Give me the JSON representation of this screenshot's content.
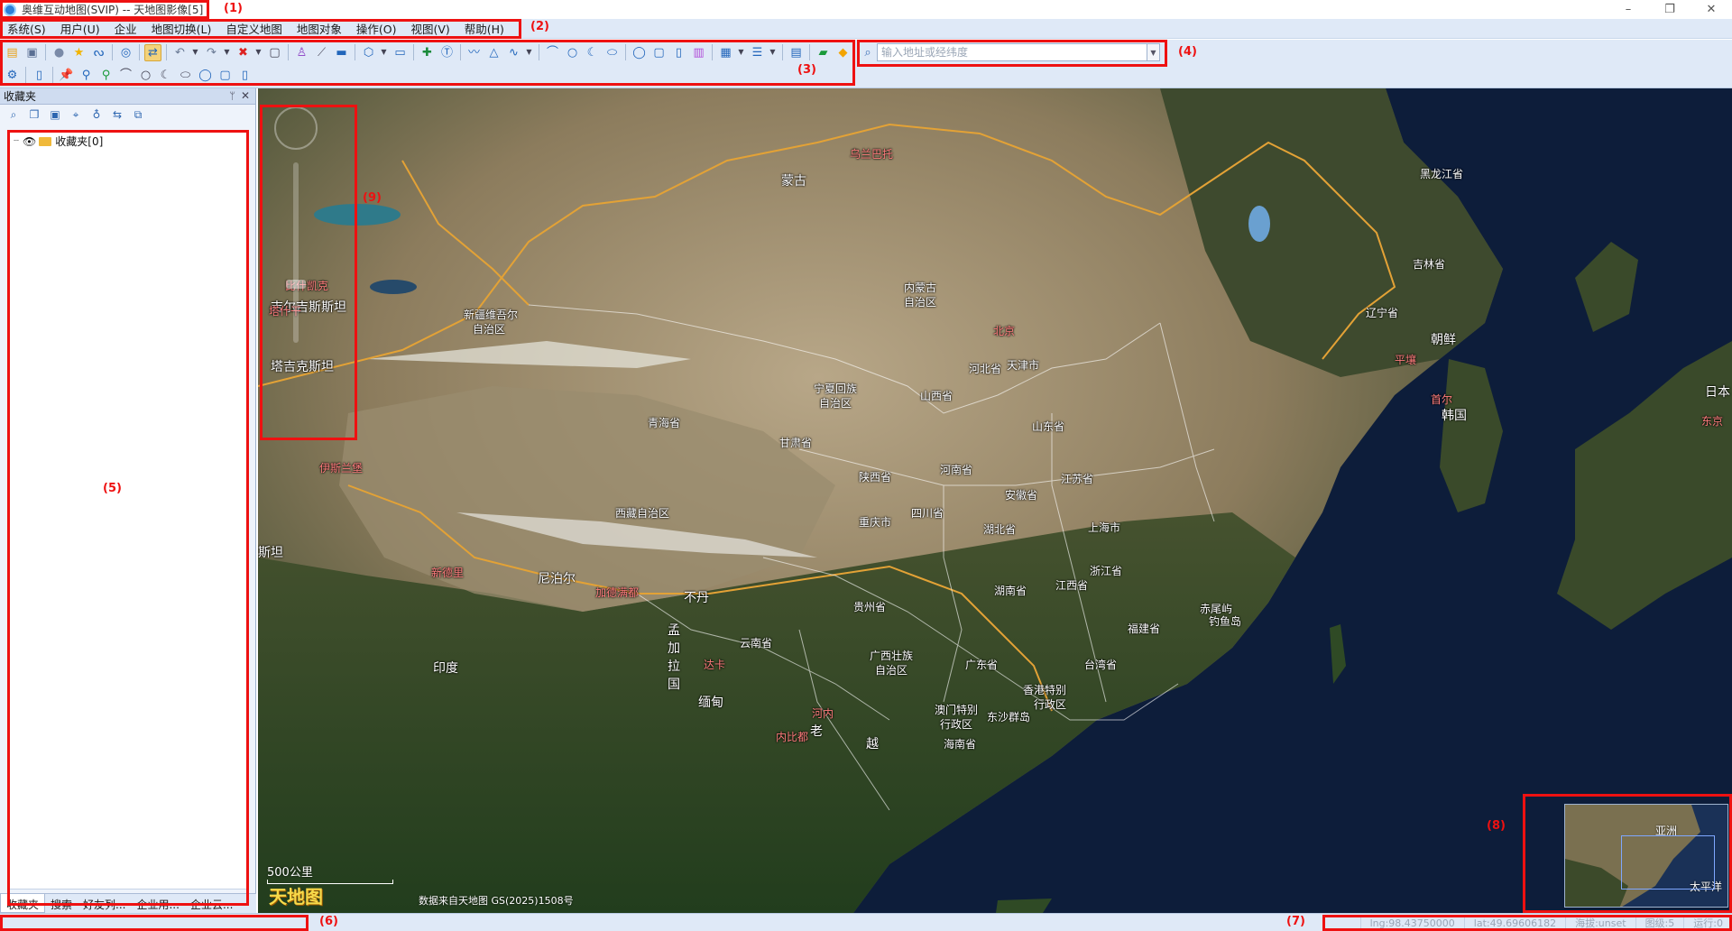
{
  "window": {
    "title": "奥维互动地图(SVIP) -- 天地图影像[5]"
  },
  "menu": [
    "系统(S)",
    "用户(U)",
    "企业",
    "地图切换(L)",
    "自定义地图",
    "地图对象",
    "操作(O)",
    "视图(V)",
    "帮助(H)"
  ],
  "search": {
    "placeholder": "输入地址或经纬度"
  },
  "panel": {
    "title": "收藏夹",
    "tree": [
      {
        "label": "收藏夹[0]"
      }
    ],
    "tabs": [
      "收藏夹",
      "搜索",
      "好友列...",
      "企业用...",
      "企业云..."
    ]
  },
  "map": {
    "scale": "500公里",
    "logo": "天地图",
    "attribution": "数据来自天地图 GS(2025)1508号",
    "labels": [
      {
        "text": "乌兰巴托",
        "kind": "cap"
      },
      {
        "text": "蒙古",
        "kind": "country"
      },
      {
        "text": "黑龙江省",
        "kind": "prov"
      },
      {
        "text": "吉林省",
        "kind": "prov"
      },
      {
        "text": "辽宁省",
        "kind": "prov"
      },
      {
        "text": "内蒙古",
        "kind": "prov"
      },
      {
        "text": "自治区",
        "kind": "prov"
      },
      {
        "text": "新疆维吾尔",
        "kind": "prov"
      },
      {
        "text": "自治区",
        "kind": "prov"
      },
      {
        "text": "比什凯克",
        "kind": "cap"
      },
      {
        "text": "吉尔吉斯斯坦",
        "kind": "country"
      },
      {
        "text": "塔什干",
        "kind": "cap"
      },
      {
        "text": "塔吉克斯坦",
        "kind": "country"
      },
      {
        "text": "北京",
        "kind": "cap"
      },
      {
        "text": "河北省",
        "kind": "prov"
      },
      {
        "text": "天津市",
        "kind": "prov"
      },
      {
        "text": "朝鲜",
        "kind": "country"
      },
      {
        "text": "平壤",
        "kind": "cap"
      },
      {
        "text": "首尔",
        "kind": "cap"
      },
      {
        "text": "韩国",
        "kind": "country"
      },
      {
        "text": "日本",
        "kind": "country"
      },
      {
        "text": "东京",
        "kind": "cap"
      },
      {
        "text": "宁夏回族",
        "kind": "prov"
      },
      {
        "text": "自治区",
        "kind": "prov"
      },
      {
        "text": "山西省",
        "kind": "prov"
      },
      {
        "text": "山东省",
        "kind": "prov"
      },
      {
        "text": "青海省",
        "kind": "prov"
      },
      {
        "text": "甘肃省",
        "kind": "prov"
      },
      {
        "text": "陕西省",
        "kind": "prov"
      },
      {
        "text": "河南省",
        "kind": "prov"
      },
      {
        "text": "江苏省",
        "kind": "prov"
      },
      {
        "text": "安徽省",
        "kind": "prov"
      },
      {
        "text": "上海市",
        "kind": "prov"
      },
      {
        "text": "伊斯兰堡",
        "kind": "cap"
      },
      {
        "text": "西藏自治区",
        "kind": "prov"
      },
      {
        "text": "四川省",
        "kind": "prov"
      },
      {
        "text": "重庆市",
        "kind": "prov"
      },
      {
        "text": "湖北省",
        "kind": "prov"
      },
      {
        "text": "浙江省",
        "kind": "prov"
      },
      {
        "text": "斯坦",
        "kind": "country"
      },
      {
        "text": "新德里",
        "kind": "cap"
      },
      {
        "text": "尼泊尔",
        "kind": "country"
      },
      {
        "text": "加德满都",
        "kind": "cap"
      },
      {
        "text": "不丹",
        "kind": "country"
      },
      {
        "text": "湖南省",
        "kind": "prov"
      },
      {
        "text": "江西省",
        "kind": "prov"
      },
      {
        "text": "贵州省",
        "kind": "prov"
      },
      {
        "text": "赤尾屿",
        "kind": "prov"
      },
      {
        "text": "钓鱼岛",
        "kind": "prov"
      },
      {
        "text": "福建省",
        "kind": "prov"
      },
      {
        "text": "孟",
        "kind": "country"
      },
      {
        "text": "加",
        "kind": "country"
      },
      {
        "text": "拉",
        "kind": "country"
      },
      {
        "text": "国",
        "kind": "country"
      },
      {
        "text": "达卡",
        "kind": "cap"
      },
      {
        "text": "云南省",
        "kind": "prov"
      },
      {
        "text": "广西壮族",
        "kind": "prov"
      },
      {
        "text": "自治区",
        "kind": "prov"
      },
      {
        "text": "广东省",
        "kind": "prov"
      },
      {
        "text": "台湾省",
        "kind": "prov"
      },
      {
        "text": "印度",
        "kind": "country"
      },
      {
        "text": "缅甸",
        "kind": "country"
      },
      {
        "text": "香港特别",
        "kind": "prov"
      },
      {
        "text": "行政区",
        "kind": "prov"
      },
      {
        "text": "澳门特别",
        "kind": "prov"
      },
      {
        "text": "行政区",
        "kind": "prov"
      },
      {
        "text": "东沙群岛",
        "kind": "prov"
      },
      {
        "text": "河内",
        "kind": "cap"
      },
      {
        "text": "老",
        "kind": "country"
      },
      {
        "text": "内比都",
        "kind": "cap"
      },
      {
        "text": "越",
        "kind": "country"
      },
      {
        "text": "海南省",
        "kind": "prov"
      }
    ],
    "overview_labels": [
      "亚洲",
      "太平洋"
    ]
  },
  "status": {
    "lng": "lng:98.43750000",
    "lat": "lat:49.69606182",
    "alt": "海拔:unset",
    "level": "图级:5",
    "running": "运行:0"
  },
  "annotations": [
    "(1)",
    "(2)",
    "(3)",
    "(4)",
    "(5)",
    "(6)",
    "(7)",
    "(8)",
    "(9)"
  ],
  "icons": {
    "row1": [
      "open-folder-icon",
      "save-icon",
      "user-icon",
      "star-icon",
      "route-icon",
      "layers-icon",
      "map-switch-icon",
      "undo-icon",
      "redo-icon",
      "delete-icon",
      "square-icon",
      "person-marker-icon",
      "ruler-icon",
      "measure-area-icon",
      "hexagon-icon",
      "video-icon",
      "pin-add-icon",
      "text-icon",
      "polyline-icon",
      "triangle-icon",
      "curve-icon",
      "arc-icon",
      "circle-icon",
      "crescent-icon",
      "ellipse-icon",
      "circle-outline-icon",
      "rect-icon",
      "doc-icon",
      "bars-icon",
      "panel-icon",
      "list-icon",
      "table-icon",
      "message-icon",
      "gem-icon"
    ],
    "row2": [
      "gear-icon",
      "page-icon",
      "pin-yellow-icon",
      "pin-blue-icon",
      "pin-green-icon",
      "line-icon",
      "circle-icon",
      "crescent-icon",
      "ellipse-icon",
      "circle-icon",
      "square-icon",
      "page-icon"
    ]
  },
  "colors": {
    "accent": "#2d7fd8",
    "annotation": "#e11111",
    "menu_bg": "#dfe9f7"
  }
}
